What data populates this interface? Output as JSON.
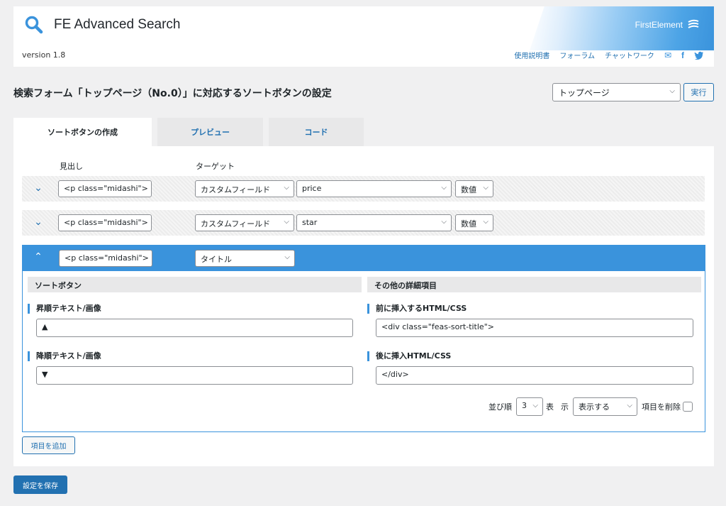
{
  "app": {
    "title": "FE Advanced Search",
    "version": "version 1.8",
    "brand": "FirstElement",
    "links": [
      "使用説明書",
      "フォーラム",
      "チャットワーク"
    ]
  },
  "page": {
    "title": "検索フォーム「トップページ（No.0）」に対応するソートボタンの設定",
    "form_select_value": "トップページ",
    "run_label": "実行"
  },
  "tabs": [
    {
      "label": "ソートボタンの作成",
      "active": true
    },
    {
      "label": "プレビュー",
      "active": false
    },
    {
      "label": "コード",
      "active": false
    }
  ],
  "columns": {
    "heading": "見出し",
    "target": "ターゲット"
  },
  "rows": [
    {
      "heading": "<p class=\"midashi\">",
      "target": "カスタムフィールド",
      "field": "price",
      "type": "数値"
    },
    {
      "heading": "<p class=\"midashi\">",
      "target": "カスタムフィールド",
      "field": "star",
      "type": "数値"
    },
    {
      "heading": "<p class=\"midashi\">",
      "target": "タイトル"
    }
  ],
  "detail": {
    "sort_section": "ソートボタン",
    "other_section": "その他の詳細項目",
    "asc_label": "昇順テキスト/画像",
    "asc_value": "▲",
    "desc_label": "降順テキスト/画像",
    "desc_value": "▼",
    "before_label": "前に挿入するHTML/CSS",
    "before_value": "<div class=\"feas-sort-title\">",
    "after_label": "後に挿入HTML/CSS",
    "after_value": "</div>",
    "order_label": "並び順",
    "order_value": "3",
    "display_label_1": "表",
    "display_label_2": "示",
    "display_value": "表示する",
    "delete_label": "項目を削除"
  },
  "buttons": {
    "add": "項目を追加",
    "save": "設定を保存"
  },
  "colors": {
    "accent": "#3a93dc",
    "link": "#2271b1"
  }
}
